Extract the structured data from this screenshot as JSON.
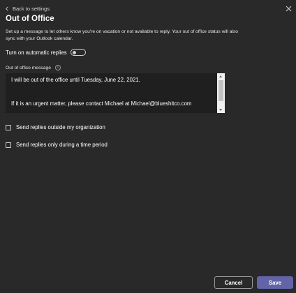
{
  "nav": {
    "back_label": "Back to settings"
  },
  "page": {
    "title": "Out of Office",
    "description": "Set up a message to let others know you're on vacation or not available to reply. Your out of office status will also sync with your Outlook calendar."
  },
  "auto_replies": {
    "label": "Turn on automatic replies",
    "enabled": false
  },
  "message": {
    "label": "Out of office message",
    "lines": [
      "I will be out of the office until Tuesday, June 22, 2021.",
      "If it is an urgent matter, please contact Michael at Michael@blueshitco.com"
    ]
  },
  "options": {
    "outside_org_label": "Send replies outside my organization",
    "outside_org_checked": false,
    "time_period_label": "Send replies only during a time period",
    "time_period_checked": false
  },
  "footer": {
    "cancel_label": "Cancel",
    "save_label": "Save"
  },
  "colors": {
    "background": "#292929",
    "accent": "#6264a7",
    "textarea_bg": "#1f1f1f"
  }
}
